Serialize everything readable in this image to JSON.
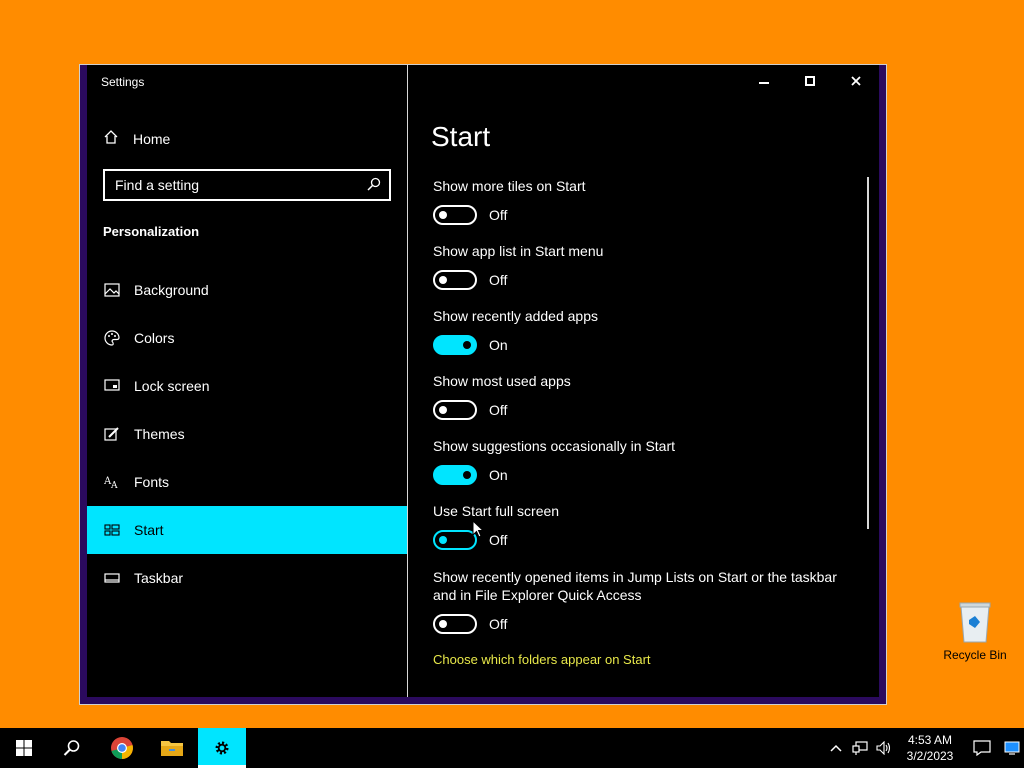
{
  "desktop": {
    "recycle_bin_label": "Recycle Bin"
  },
  "window": {
    "title": "Settings",
    "home_label": "Home",
    "search_placeholder": "Find a setting",
    "section_title": "Personalization",
    "nav_items": [
      {
        "label": "Background",
        "icon": "picture-icon",
        "active": false
      },
      {
        "label": "Colors",
        "icon": "palette-icon",
        "active": false
      },
      {
        "label": "Lock screen",
        "icon": "monitor-icon",
        "active": false
      },
      {
        "label": "Themes",
        "icon": "brush-icon",
        "active": false
      },
      {
        "label": "Fonts",
        "icon": "font-icon",
        "active": true
      },
      {
        "label": "Start",
        "icon": "start-icon",
        "active": true
      },
      {
        "label": "Taskbar",
        "icon": "taskbar-icon",
        "active": false
      }
    ]
  },
  "content": {
    "page_title": "Start",
    "settings": [
      {
        "label": "Show more tiles on Start",
        "state": "Off",
        "on": false
      },
      {
        "label": "Show app list in Start menu",
        "state": "Off",
        "on": false
      },
      {
        "label": "Show recently added apps",
        "state": "On",
        "on": true
      },
      {
        "label": "Show most used apps",
        "state": "Off",
        "on": false
      },
      {
        "label": "Show suggestions occasionally in Start",
        "state": "On",
        "on": true
      },
      {
        "label": "Use Start full screen",
        "state": "Off",
        "on": false
      },
      {
        "label": "Show recently opened items in Jump Lists on Start or the taskbar and in File Explorer Quick Access",
        "state": "Off",
        "on": false
      }
    ],
    "link": "Choose which folders appear on Start"
  },
  "taskbar": {
    "time": "4:53 AM",
    "date": "3/2/2023"
  },
  "colors": {
    "accent": "#00e5ff",
    "desktop": "#ff8c00",
    "link": "#e8e84a"
  }
}
